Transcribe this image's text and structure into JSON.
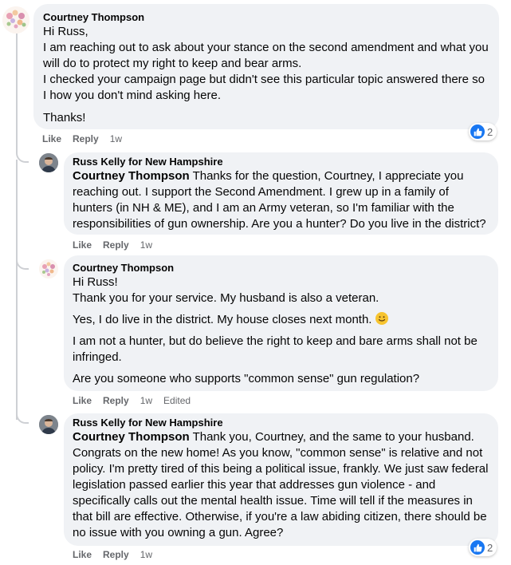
{
  "comments": [
    {
      "author": "Courtney Thompson",
      "paragraphs": [
        "Hi Russ,",
        "I am reaching out to ask about your stance on the second amendment and what you will do to protect my right to keep and bear arms.",
        "I checked your campaign page but didn't see this particular topic answered there so I how you don't mind asking here.",
        "Thanks!"
      ],
      "like_label": "Like",
      "reply_label": "Reply",
      "time": "1w",
      "reaction_count": "2"
    },
    {
      "author": "Russ Kelly for New Hampshire",
      "mention": "Courtney Thompson",
      "text": " Thanks for the question, Courtney, I appreciate you reaching out. I support the Second Amendment. I grew up in a family of hunters (in NH & ME), and I am an Army veteran, so I'm familiar with the responsibilities of gun ownership. Are you a hunter? Do you live in the district?",
      "like_label": "Like",
      "reply_label": "Reply",
      "time": "1w"
    },
    {
      "author": "Courtney Thompson",
      "paragraphs": [
        "Hi Russ!",
        "Thank you for your service. My husband is also a veteran.",
        "Yes, I do live in the district. My house closes next month.",
        "I am not a hunter, but do believe the right to keep and bare arms shall not be infringed.",
        "Are you someone who supports \"common sense\" gun regulation?"
      ],
      "like_label": "Like",
      "reply_label": "Reply",
      "time": "1w",
      "edited_label": "Edited",
      "emoji": "slightly-smiling-face"
    },
    {
      "author": "Russ Kelly for New Hampshire",
      "mention": "Courtney Thompson",
      "text": " Thank you, Courtney, and the same to your husband. Congrats on the new home! As you know, \"common sense\" is relative and not policy. I'm pretty tired of this being a political issue, frankly. We just saw federal legislation passed earlier this year that addresses gun violence - and specifically calls out the mental health issue. Time will tell if the measures in that bill are effective. Otherwise, if you're a law abiding citizen, there should be no issue with you owning a gun. Agree?",
      "like_label": "Like",
      "reply_label": "Reply",
      "time": "1w",
      "reaction_count": "2"
    }
  ],
  "colors": {
    "bubble": "#f0f2f5",
    "meta_text": "#65676b",
    "like_blue": "#1877f2"
  }
}
